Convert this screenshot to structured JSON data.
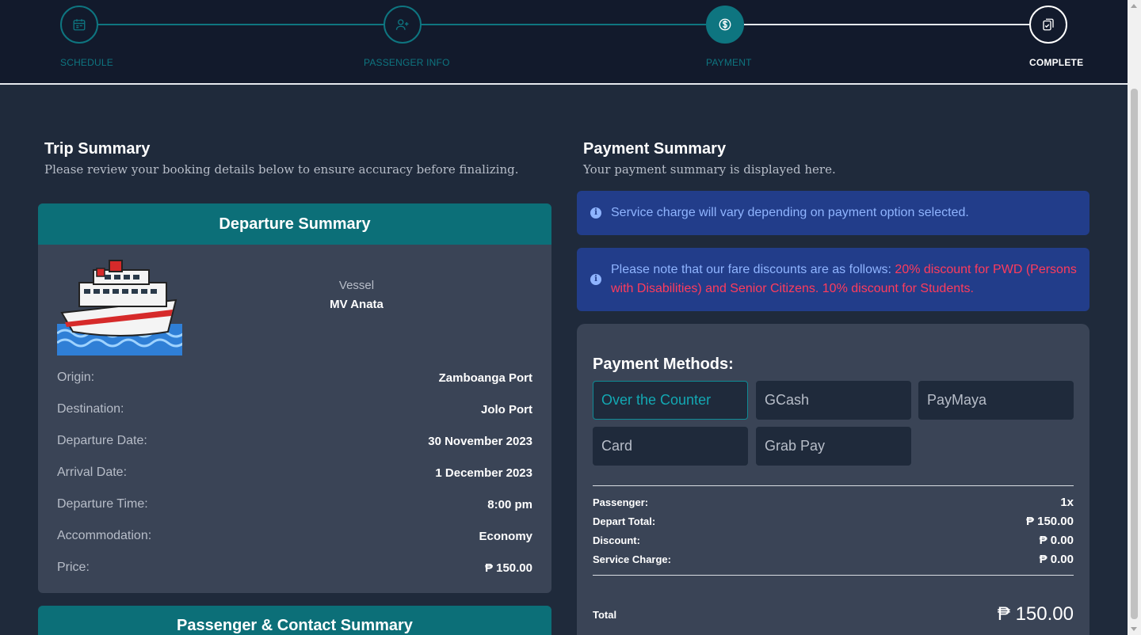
{
  "stepper": {
    "steps": [
      {
        "label": "SCHEDULE",
        "icon": "calendar-icon",
        "state": "done"
      },
      {
        "label": "PASSENGER INFO",
        "icon": "user-plus-icon",
        "state": "done"
      },
      {
        "label": "PAYMENT",
        "icon": "dollar-icon",
        "state": "active"
      },
      {
        "label": "COMPLETE",
        "icon": "clipboard-check-icon",
        "state": "pending"
      }
    ]
  },
  "trip": {
    "title": "Trip Summary",
    "subtitle": "Please review your booking details below to ensure accuracy before finalizing.",
    "departure": {
      "header": "Departure Summary",
      "vessel_label": "Vessel",
      "vessel_name": "MV Anata",
      "rows": [
        {
          "label": "Origin:",
          "value": "Zamboanga Port"
        },
        {
          "label": "Destination:",
          "value": "Jolo Port"
        },
        {
          "label": "Departure Date:",
          "value": "30 November 2023"
        },
        {
          "label": "Arrival Date:",
          "value": "1 December 2023"
        },
        {
          "label": "Departure Time:",
          "value": "8:00 pm"
        },
        {
          "label": "Accommodation:",
          "value": "Economy"
        },
        {
          "label": "Price:",
          "value": "₱ 150.00"
        }
      ]
    },
    "passenger_header": "Passenger & Contact Summary"
  },
  "payment": {
    "title": "Payment Summary",
    "subtitle": "Your payment summary is displayed here.",
    "alert_service": "Service charge will vary depending on payment option selected.",
    "alert_discount_prefix": "Please note that our fare discounts are as follows: ",
    "alert_discount_highlight": "20% discount for PWD (Persons with Disabilities) and Senior Citizens. 10% discount for Students.",
    "methods_title": "Payment Methods:",
    "methods": [
      "Over the Counter",
      "GCash",
      "PayMaya",
      "Card",
      "Grab Pay"
    ],
    "selected_method": "Over the Counter",
    "summary": [
      {
        "label": "Passenger:",
        "value": "1x"
      },
      {
        "label": "Depart Total:",
        "value": "₱ 150.00"
      },
      {
        "label": "Discount:",
        "value": "₱ 0.00"
      },
      {
        "label": "Service Charge:",
        "value": "₱ 0.00"
      }
    ],
    "total_label": "Total",
    "total_value": "₱ 150.00"
  },
  "colors": {
    "accent": "#0e7580",
    "header_bg": "#121a2c",
    "page_bg": "#1f2a3b",
    "card_bg": "#3a4456",
    "alert_bg": "#223d8a",
    "alert_text": "#8fb4ff",
    "highlight": "#ff3b5c"
  }
}
